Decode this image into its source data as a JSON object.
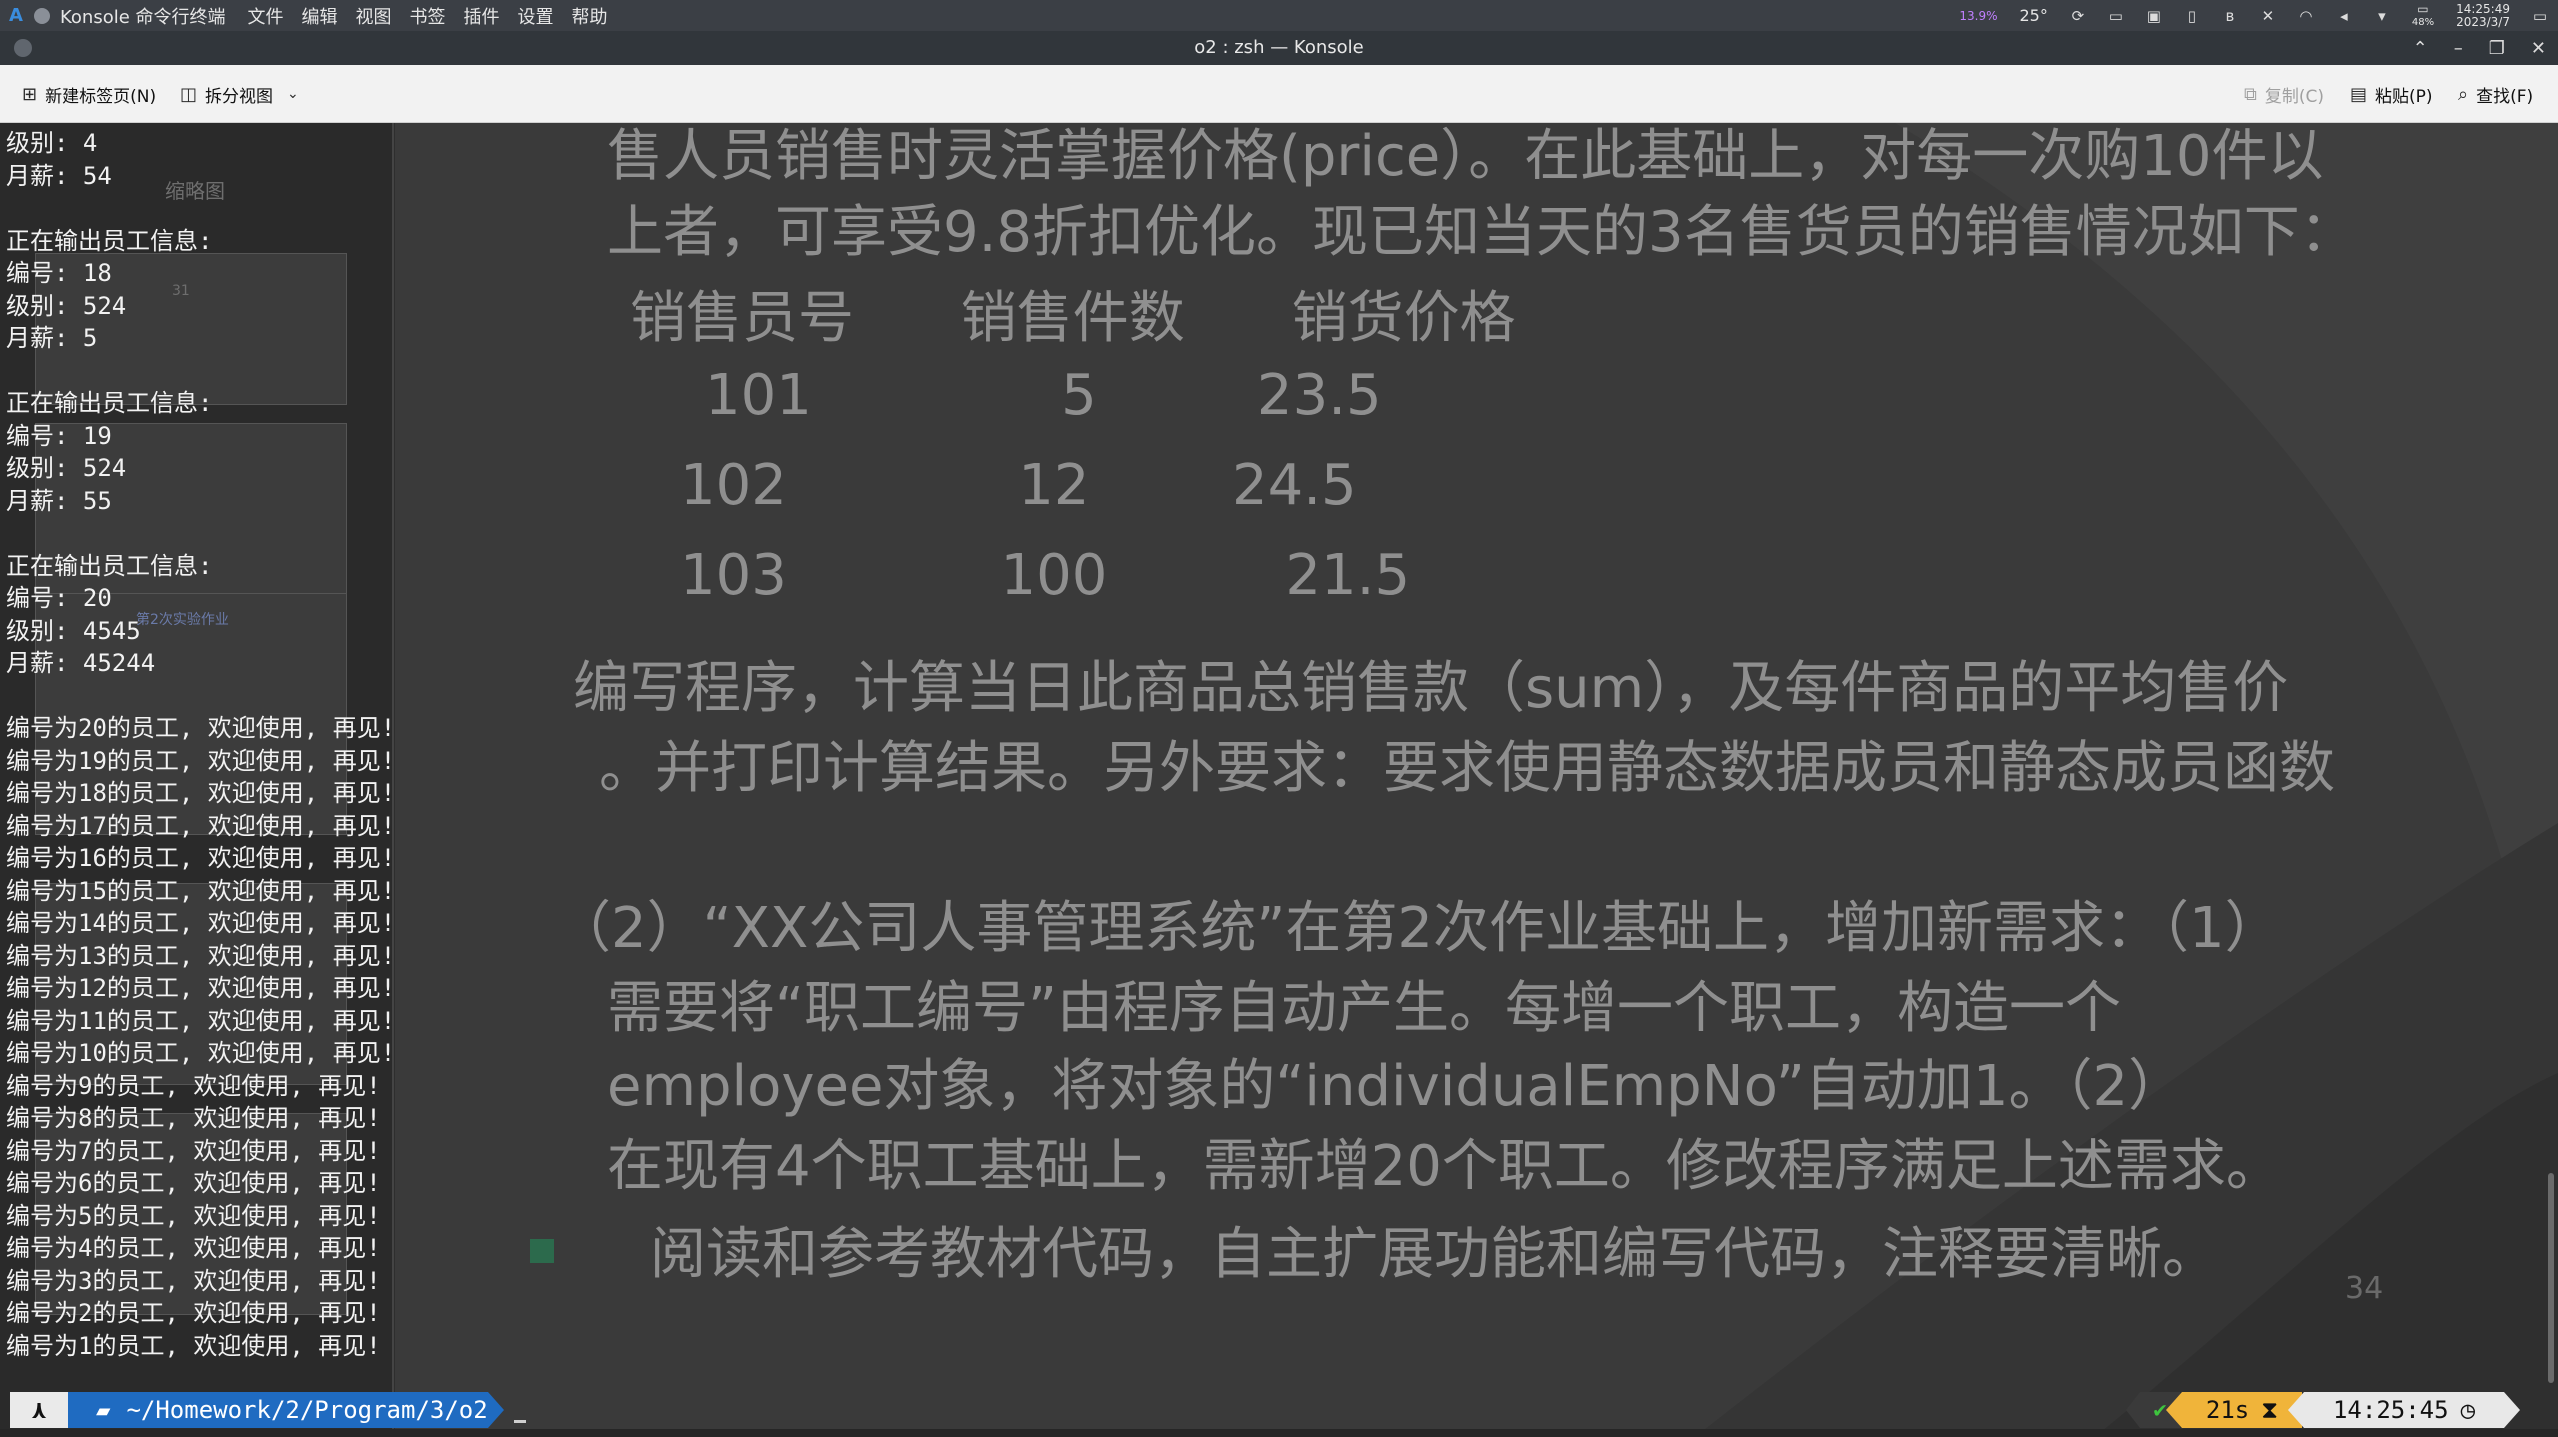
{
  "system_panel": {
    "app_name": "Konsole 命令行终端",
    "menu": [
      "文件",
      "编辑",
      "视图",
      "书签",
      "插件",
      "设置",
      "帮助"
    ],
    "cpu_usage": "13.9%",
    "temperature": "25°",
    "battery": "48%",
    "time": "14:25:49",
    "date": "2023/3/7"
  },
  "window": {
    "title": "o2 : zsh — Konsole"
  },
  "toolbar": {
    "new_tab": "新建标签页(N)",
    "split_view": "拆分视图",
    "copy": "复制(C)",
    "paste": "粘贴(P)",
    "find": "查找(F)"
  },
  "terminal": {
    "lines": [
      "级别: 4",
      "月薪: 54",
      "",
      "正在输出员工信息:",
      "编号: 18",
      "级别: 524",
      "月薪: 5",
      "",
      "正在输出员工信息:",
      "编号: 19",
      "级别: 524",
      "月薪: 55",
      "",
      "正在输出员工信息:",
      "编号: 20",
      "级别: 4545",
      "月薪: 45244",
      "",
      "编号为20的员工, 欢迎使用, 再见!",
      "编号为19的员工, 欢迎使用, 再见!",
      "编号为18的员工, 欢迎使用, 再见!",
      "编号为17的员工, 欢迎使用, 再见!",
      "编号为16的员工, 欢迎使用, 再见!",
      "编号为15的员工, 欢迎使用, 再见!",
      "编号为14的员工, 欢迎使用, 再见!",
      "编号为13的员工, 欢迎使用, 再见!",
      "编号为12的员工, 欢迎使用, 再见!",
      "编号为11的员工, 欢迎使用, 再见!",
      "编号为10的员工, 欢迎使用, 再见!",
      "编号为9的员工, 欢迎使用, 再见!",
      "编号为8的员工, 欢迎使用, 再见!",
      "编号为7的员工, 欢迎使用, 再见!",
      "编号为6的员工, 欢迎使用, 再见!",
      "编号为5的员工, 欢迎使用, 再见!",
      "编号为4的员工, 欢迎使用, 再见!",
      "编号为3的员工, 欢迎使用, 再见!",
      "编号为2的员工, 欢迎使用, 再见!",
      "编号为1的员工, 欢迎使用, 再见!"
    ],
    "prompt": {
      "os_symbol": "⋏",
      "directory": "~/Homework/2/Program/3/o2",
      "status_ok": "✔",
      "duration": "21s",
      "clock": "14:25:45"
    }
  },
  "wallpaper": {
    "thumb_label": "缩略图",
    "slide_lines": [
      "售人员销售时灵活掌握价格(price）。在此基础上，对每一次购10件以",
      "上者，可享受9.8折扣优化。现已知当天的3名售货员的销售情况如下：",
      "销售员号      销售件数      销货价格",
      "101              5         23.5",
      "102             12        24.5",
      "103            100          21.5",
      "编写程序，计算当日此商品总销售款（sum），及每件商品的平均售价",
      "。并打印计算结果。另外要求：要求使用静态数据成员和静态成员函数",
      "（2）“XX公司人事管理系统”在第2次作业基础上，增加新需求：（1）",
      "需要将“职工编号”由程序自动产生。每增一个职工，构造一个",
      "employee对象，将对象的“individualEmpNo”自动加1。（2）",
      "在现有4个职工基础上，需新增20个职工。修改程序满足上述需求。",
      "阅读和参考教材代码，自主扩展功能和编写代码，注释要清晰。"
    ],
    "page_number": "34",
    "thumb_number": "31",
    "thumb_caption": "第2次实验作业"
  }
}
